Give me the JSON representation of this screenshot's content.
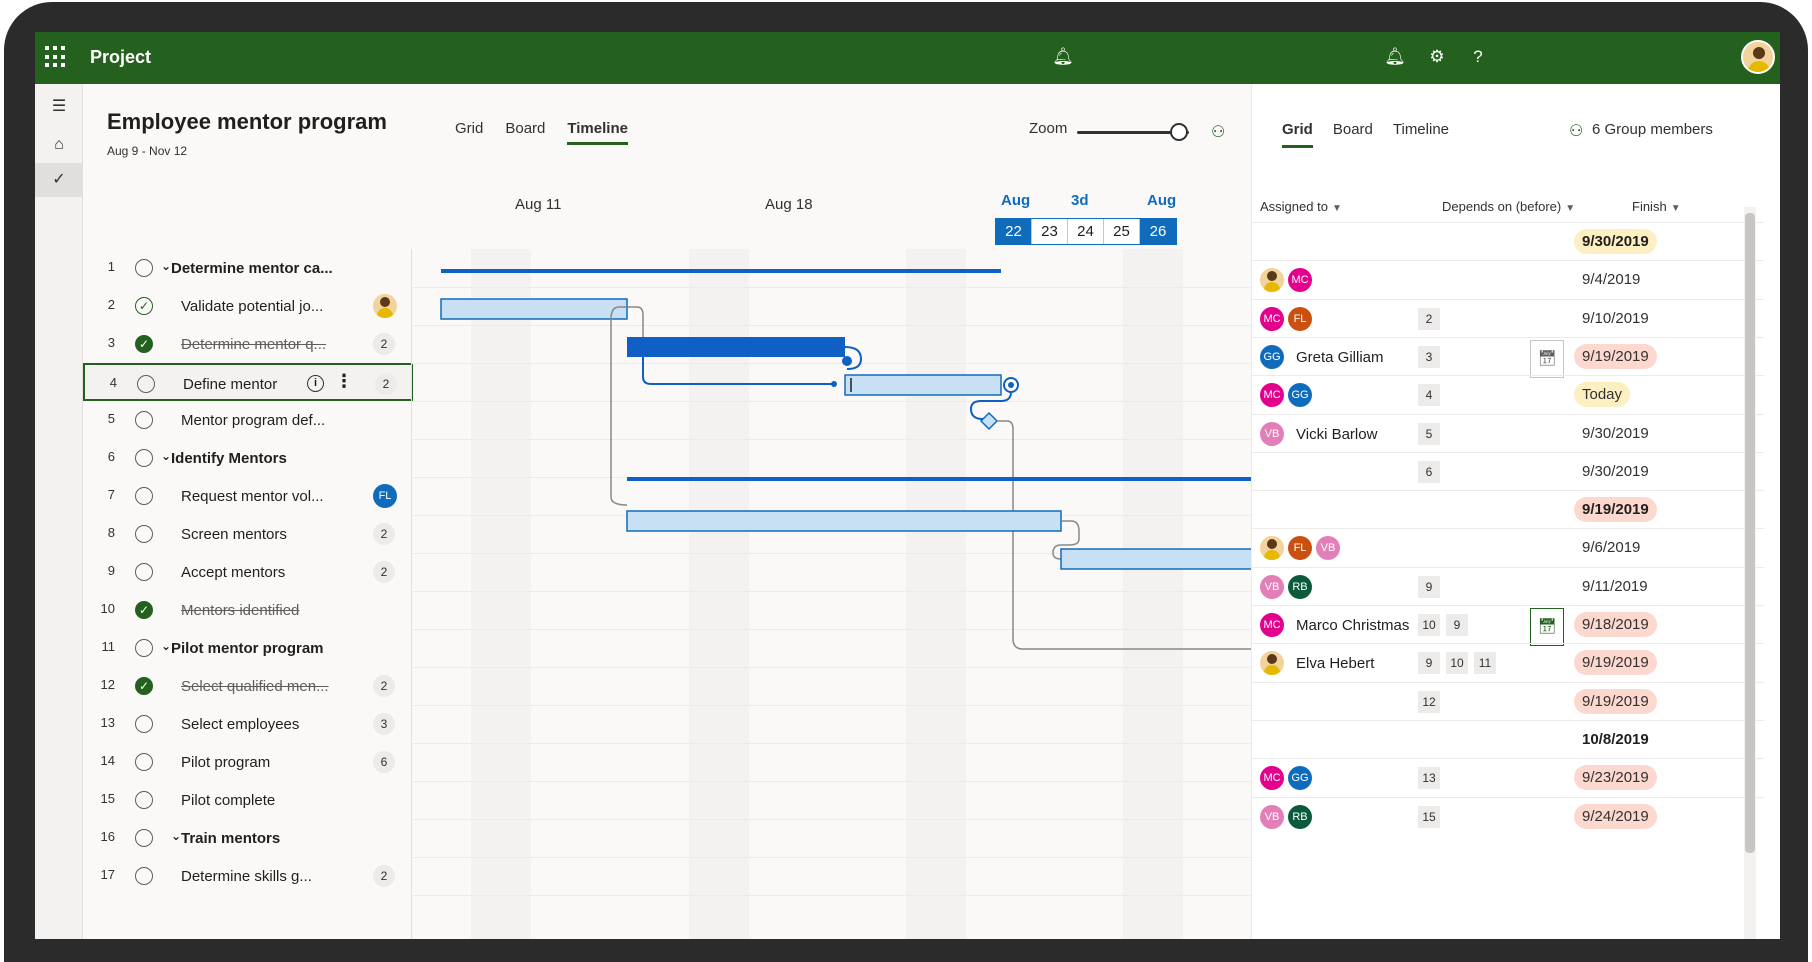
{
  "app": {
    "name": "Project"
  },
  "project": {
    "title": "Employee mentor program",
    "dates": "Aug 9 - Nov 12"
  },
  "view_tabs": [
    "Grid",
    "Board",
    "Timeline"
  ],
  "zoom_label": "Zoom",
  "zoom_level": 0.9,
  "timeline": {
    "week_labels": [
      "Aug 11",
      "Aug 18"
    ],
    "focus_labels": [
      "Aug",
      "3d",
      "Aug"
    ],
    "days": [
      "22",
      "23",
      "24",
      "25",
      "26"
    ]
  },
  "tasks": [
    {
      "num": "1",
      "name": "Determine mentor ca...",
      "group": true,
      "status": "open",
      "badge": null
    },
    {
      "num": "2",
      "name": "Validate potential jo...",
      "group": false,
      "status": "open-done",
      "badge": "photo"
    },
    {
      "num": "3",
      "name": "Determine mentor q...",
      "group": false,
      "status": "done",
      "badge": "2"
    },
    {
      "num": "4",
      "name": "Define mentor",
      "group": false,
      "status": "open",
      "badge": "2"
    },
    {
      "num": "5",
      "name": "Mentor program def...",
      "group": false,
      "status": "open",
      "badge": null
    },
    {
      "num": "6",
      "name": "Identify Mentors",
      "group": true,
      "status": "open",
      "badge": null
    },
    {
      "num": "7",
      "name": "Request mentor vol...",
      "group": false,
      "status": "open",
      "badge": "FL"
    },
    {
      "num": "8",
      "name": "Screen mentors",
      "group": false,
      "status": "open",
      "badge": "2"
    },
    {
      "num": "9",
      "name": "Accept mentors",
      "group": false,
      "status": "open",
      "badge": "2"
    },
    {
      "num": "10",
      "name": "Mentors identified",
      "group": false,
      "status": "done",
      "badge": null
    },
    {
      "num": "11",
      "name": "Pilot mentor program",
      "group": true,
      "status": "open",
      "badge": null
    },
    {
      "num": "12",
      "name": "Select qualified men...",
      "group": false,
      "status": "done",
      "badge": "2"
    },
    {
      "num": "13",
      "name": "Select employees",
      "group": false,
      "status": "open",
      "badge": "3"
    },
    {
      "num": "14",
      "name": "Pilot program",
      "group": false,
      "status": "open",
      "badge": "6"
    },
    {
      "num": "15",
      "name": "Pilot complete",
      "group": false,
      "status": "open",
      "badge": null
    },
    {
      "num": "16",
      "name": "Train mentors",
      "group": true,
      "status": "open",
      "badge": null
    },
    {
      "num": "17",
      "name": "Determine skills g...",
      "group": false,
      "status": "open",
      "badge": "2"
    }
  ],
  "right_panel": {
    "tabs": [
      "Grid",
      "Board",
      "Timeline"
    ],
    "members_label": "6 Group members",
    "columns": {
      "assigned": "Assigned to",
      "depends": "Depends on (before)",
      "finish": "Finish"
    },
    "rows": [
      {
        "assignees": [],
        "name": "",
        "deps": [],
        "finish": "9/30/2019",
        "style": "bold yellow"
      },
      {
        "assignees": [
          "photo",
          "MC"
        ],
        "name": "",
        "deps": [],
        "finish": "9/4/2019",
        "style": ""
      },
      {
        "assignees": [
          "MC",
          "FL"
        ],
        "name": "",
        "deps": [
          "2"
        ],
        "finish": "9/10/2019",
        "style": ""
      },
      {
        "assignees": [
          "GG"
        ],
        "name": "Greta Gilliam",
        "deps": [
          "3"
        ],
        "finish": "9/19/2019",
        "style": "red",
        "cal": "hover"
      },
      {
        "assignees": [
          "MC",
          "GG"
        ],
        "name": "",
        "deps": [
          "4"
        ],
        "finish": "Today",
        "style": "yellow"
      },
      {
        "assignees": [
          "VB"
        ],
        "name": "Vicki Barlow",
        "deps": [
          "5"
        ],
        "finish": "9/30/2019",
        "style": ""
      },
      {
        "assignees": [],
        "name": "",
        "deps": [
          "6"
        ],
        "finish": "9/30/2019",
        "style": ""
      },
      {
        "assignees": [],
        "name": "",
        "deps": [],
        "finish": "9/19/2019",
        "style": "bold red"
      },
      {
        "assignees": [
          "photo",
          "FL",
          "VB"
        ],
        "name": "",
        "deps": [],
        "finish": "9/6/2019",
        "style": ""
      },
      {
        "assignees": [
          "VB",
          "RB"
        ],
        "name": "",
        "deps": [
          "9"
        ],
        "finish": "9/11/2019",
        "style": ""
      },
      {
        "assignees": [
          "MC"
        ],
        "name": "Marco Christmas",
        "deps": [
          "10",
          "9"
        ],
        "finish": "9/18/2019",
        "style": "red",
        "cal": "box"
      },
      {
        "assignees": [
          "photo"
        ],
        "name": "Elva Hebert",
        "deps": [
          "9",
          "10",
          "11"
        ],
        "finish": "9/19/2019",
        "style": "red"
      },
      {
        "assignees": [],
        "name": "",
        "deps": [
          "12"
        ],
        "finish": "9/19/2019",
        "style": "red"
      },
      {
        "assignees": [],
        "name": "",
        "deps": [],
        "finish": "10/8/2019",
        "style": "bold"
      },
      {
        "assignees": [
          "MC",
          "GG"
        ],
        "name": "",
        "deps": [
          "13"
        ],
        "finish": "9/23/2019",
        "style": "red"
      },
      {
        "assignees": [
          "VB",
          "RB"
        ],
        "name": "",
        "deps": [
          "15"
        ],
        "finish": "9/24/2019",
        "style": "red"
      }
    ]
  },
  "avatar_colors": {
    "MC": "#e3008c",
    "FL": "#ca5010",
    "GG": "#0f6cbd",
    "VB": "#e37fb8",
    "RB": "#0b5a3c"
  },
  "colors": {
    "brand": "#24611f",
    "bar_fill": "#c7e0f4",
    "bar_stroke": "#0f6cbd",
    "bar_solid": "#0f5fc5"
  }
}
